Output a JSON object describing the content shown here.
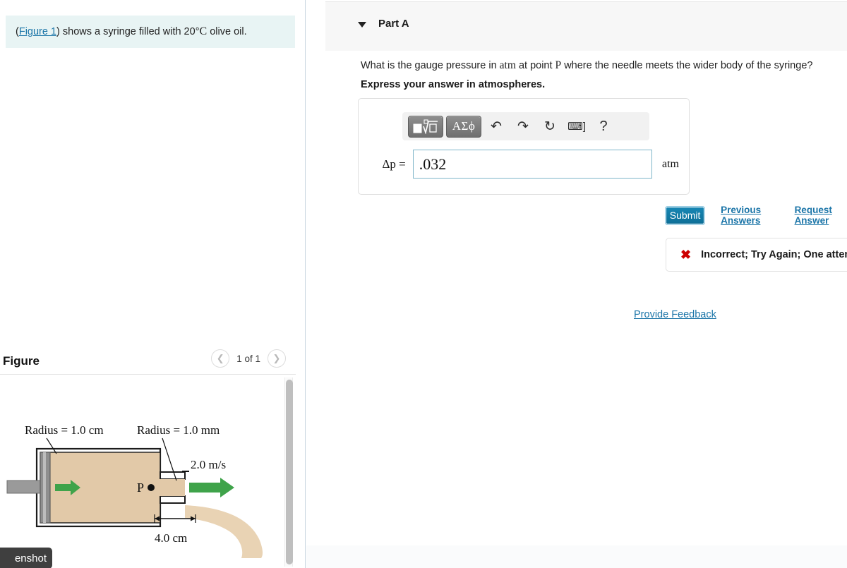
{
  "left": {
    "intro": {
      "link_text": "Figure 1",
      "before": "(",
      "after": ") shows a syringe filled with 20",
      "degree": "°",
      "unit": "C",
      "tail": " olive oil."
    },
    "figure": {
      "title": "Figure",
      "pager": {
        "prev_icon": "chevron-left-icon",
        "next_icon": "chevron-right-icon",
        "count_label": "1 of 1"
      },
      "diagram": {
        "label_body_radius": "Radius = 1.0 cm",
        "label_needle_radius": "Radius = 1.0 mm",
        "label_velocity": "2.0 m/s",
        "label_point": "P",
        "label_length": "4.0 cm",
        "oil_color": "#e2c9a8",
        "arrow_color": "#3fa34a",
        "plunger_color": "#9a9a9a"
      }
    },
    "screenshot_chip": "enshot"
  },
  "right": {
    "part": {
      "caret_icon": "caret-down-icon",
      "label": "Part A"
    },
    "question": {
      "seg1": "What is the gauge pressure in ",
      "unit": "atm",
      "seg2": " at point ",
      "point": "P",
      "seg3": " where the needle meets the wider body of the syringe?",
      "instruction": "Express your answer in atmospheres."
    },
    "answer": {
      "toolbar": {
        "template_btn_label": "√",
        "greek_btn_label": "ΑΣϕ",
        "undo_icon": "undo-icon",
        "redo_icon": "redo-icon",
        "reset_icon": "reset-icon",
        "keyboard_icon": "keyboard-icon",
        "keyboard_bracket": "]",
        "help_icon": "?"
      },
      "label": "Δp =",
      "value": ".032",
      "placeholder": "",
      "unit": "atm"
    },
    "actions": {
      "submit_label": "Submit",
      "previous_answers_label": "Previous Answers",
      "request_answer_label": "Request Answer"
    },
    "feedback": {
      "x_icon": "✖",
      "message": "Incorrect; Try Again; One attempt remaining"
    },
    "provide_feedback_label": "Provide Feedback"
  },
  "colors": {
    "accent_link": "#1b75a8",
    "submit_bg": "#0d6e96",
    "error_red": "#cc0000",
    "intro_bg": "#e8f4f4",
    "header_bg": "#f7f7f7"
  }
}
